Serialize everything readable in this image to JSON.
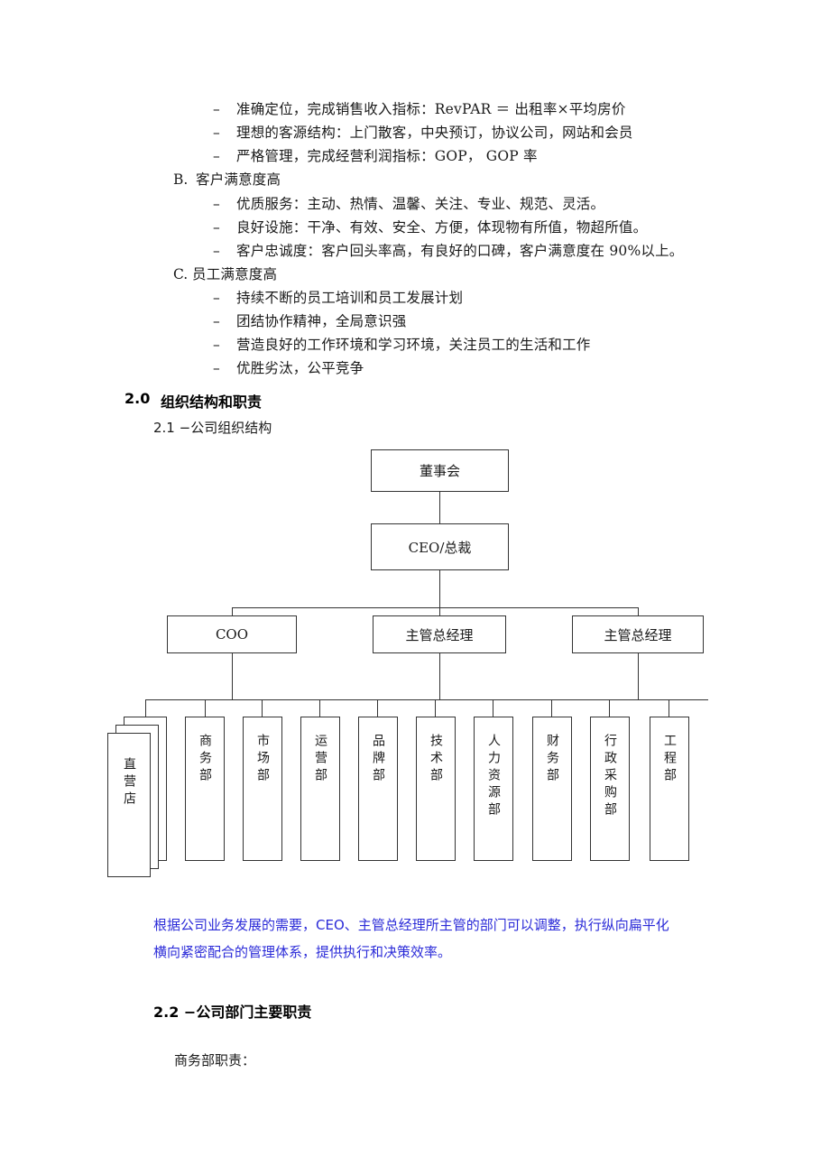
{
  "document": {
    "section_a_items": [
      "准确定位，完成销售收入指标：RevPAR ＝ 出租率×平均房价",
      "理想的客源结构：上门散客，中央预订，协议公司，网站和会员",
      "严格管理，完成经营利润指标：GOP，  GOP 率"
    ],
    "section_b": {
      "marker": "B.",
      "title": "客户满意度高",
      "items": [
        "优质服务：主动、热情、温馨、关注、专业、规范、灵活。",
        "良好设施：干净、有效、安全、方便，体现物有所值，物超所值。",
        "客户忠诚度：客户回头率高，有良好的口碑，客户满意度在 90%以上。"
      ]
    },
    "section_c": {
      "marker": "C.",
      "title": "员工满意度高",
      "items": [
        "持续不断的员工培训和员工发展计划",
        "团结协作精神，全局意识强",
        "营造良好的工作环境和学习环境，关注员工的生活和工作",
        "优胜劣汰，公平竞争"
      ]
    },
    "heading_2_0": {
      "number": "2.0",
      "text": "组织结构和职责"
    },
    "heading_2_1": "2.1 −公司组织结构",
    "heading_2_2": "2.2 −公司部门主要职责",
    "trailing_text": "商务部职责：",
    "note_paragraph": {
      "line1": "根据公司业务发展的需要，CEO、主管总经理所主管的部门可以调整，执行纵向扁平化",
      "line2": "横向紧密配合的管理体系，提供执行和决策效率。",
      "color": "#2b2bd8"
    },
    "bullet_marker": "–"
  },
  "org_chart": {
    "board": "董事会",
    "ceo": "CEO/总裁",
    "managers": [
      "COO",
      "主管总经理",
      "主管总经理"
    ],
    "departments": [
      "直营店",
      "商务部",
      "市场部",
      "运营部",
      "品牌部",
      "技术部",
      "人力资源部",
      "财务部",
      "行政采购部",
      "工程部"
    ],
    "line_color": "#333333",
    "box_fill": "#ffffff"
  }
}
